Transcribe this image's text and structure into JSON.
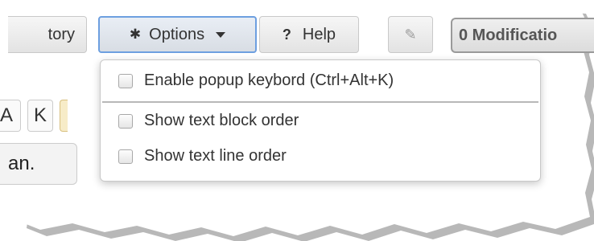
{
  "toolbar": {
    "history_label": "tory",
    "options_label": "Options",
    "help_label": "Help",
    "modifications_label": "0 Modificatio"
  },
  "background": {
    "keys": [
      "A",
      "K",
      ""
    ],
    "text_block": "an."
  },
  "options_menu": {
    "items": [
      {
        "label": "Enable popup keybord (Ctrl+Alt+K)",
        "checked": false
      },
      {
        "label": "Show text block order",
        "checked": false
      },
      {
        "label": "Show text line order",
        "checked": false
      }
    ]
  },
  "colors": {
    "active_border": "#6d9fe0",
    "button_bg": "#e8e8e8",
    "text": "#333333"
  },
  "icons": {
    "options": "gear-icon",
    "options_caret": "chevron-down-icon",
    "help": "question-icon",
    "edit": "pencil-icon"
  }
}
